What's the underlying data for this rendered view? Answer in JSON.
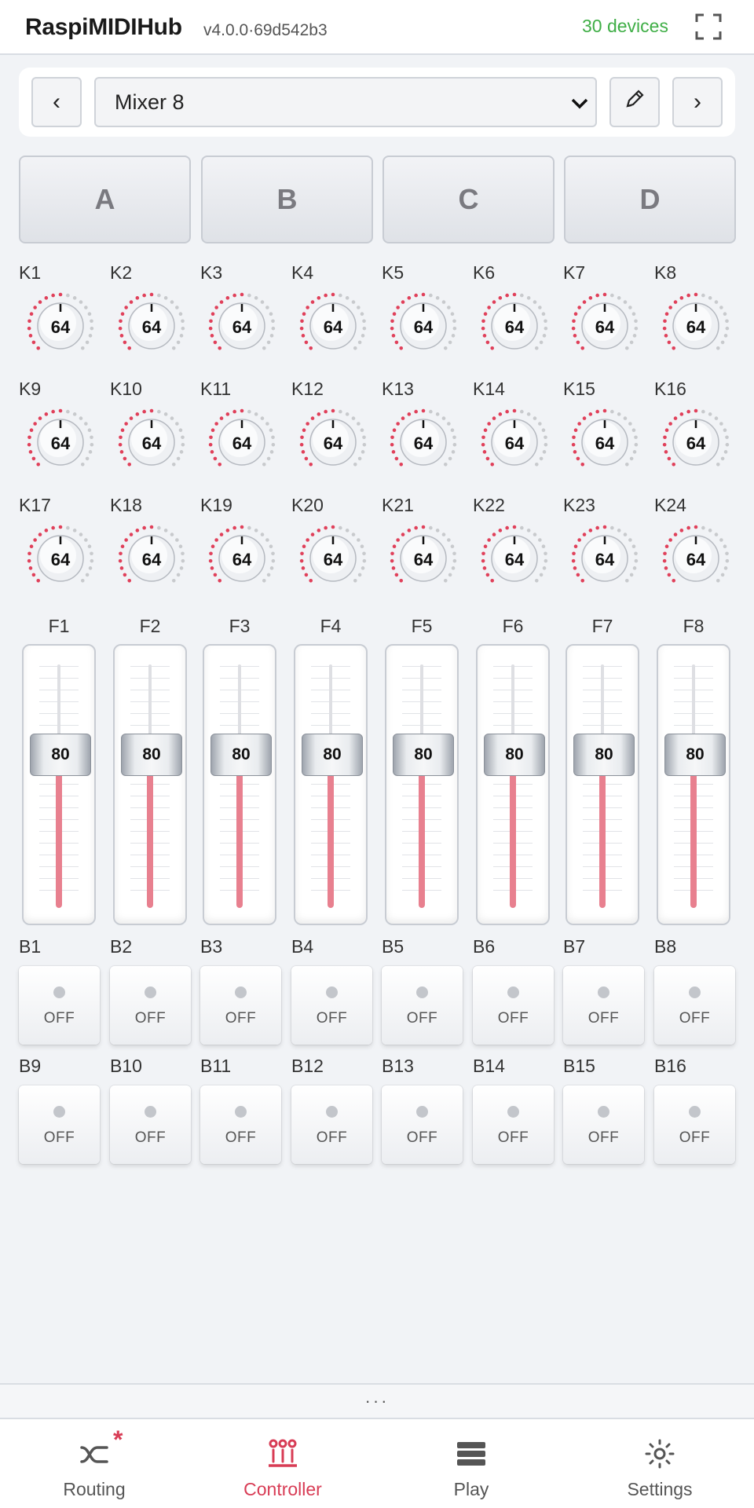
{
  "header": {
    "title": "RaspiMIDIHub",
    "version": "v4.0.0·69d542b3",
    "devices": "30 devices"
  },
  "preset": {
    "prev_label": "‹",
    "next_label": "›",
    "selected": "Mixer 8",
    "edit_icon": "pencil-icon"
  },
  "banks": [
    "A",
    "B",
    "C",
    "D"
  ],
  "knobs": [
    {
      "label": "K1",
      "value": "64"
    },
    {
      "label": "K2",
      "value": "64"
    },
    {
      "label": "K3",
      "value": "64"
    },
    {
      "label": "K4",
      "value": "64"
    },
    {
      "label": "K5",
      "value": "64"
    },
    {
      "label": "K6",
      "value": "64"
    },
    {
      "label": "K7",
      "value": "64"
    },
    {
      "label": "K8",
      "value": "64"
    },
    {
      "label": "K9",
      "value": "64"
    },
    {
      "label": "K10",
      "value": "64"
    },
    {
      "label": "K11",
      "value": "64"
    },
    {
      "label": "K12",
      "value": "64"
    },
    {
      "label": "K13",
      "value": "64"
    },
    {
      "label": "K14",
      "value": "64"
    },
    {
      "label": "K15",
      "value": "64"
    },
    {
      "label": "K16",
      "value": "64"
    },
    {
      "label": "K17",
      "value": "64"
    },
    {
      "label": "K18",
      "value": "64"
    },
    {
      "label": "K19",
      "value": "64"
    },
    {
      "label": "K20",
      "value": "64"
    },
    {
      "label": "K21",
      "value": "64"
    },
    {
      "label": "K22",
      "value": "64"
    },
    {
      "label": "K23",
      "value": "64"
    },
    {
      "label": "K24",
      "value": "64"
    }
  ],
  "knob_level": 0.5,
  "faders": [
    {
      "label": "F1",
      "value": "80"
    },
    {
      "label": "F2",
      "value": "80"
    },
    {
      "label": "F3",
      "value": "80"
    },
    {
      "label": "F4",
      "value": "80"
    },
    {
      "label": "F5",
      "value": "80"
    },
    {
      "label": "F6",
      "value": "80"
    },
    {
      "label": "F7",
      "value": "80"
    },
    {
      "label": "F8",
      "value": "80"
    }
  ],
  "fader_level": 0.63,
  "buttons": [
    {
      "label": "B1",
      "state": "OFF"
    },
    {
      "label": "B2",
      "state": "OFF"
    },
    {
      "label": "B3",
      "state": "OFF"
    },
    {
      "label": "B4",
      "state": "OFF"
    },
    {
      "label": "B5",
      "state": "OFF"
    },
    {
      "label": "B6",
      "state": "OFF"
    },
    {
      "label": "B7",
      "state": "OFF"
    },
    {
      "label": "B8",
      "state": "OFF"
    },
    {
      "label": "B9",
      "state": "OFF"
    },
    {
      "label": "B10",
      "state": "OFF"
    },
    {
      "label": "B11",
      "state": "OFF"
    },
    {
      "label": "B12",
      "state": "OFF"
    },
    {
      "label": "B13",
      "state": "OFF"
    },
    {
      "label": "B14",
      "state": "OFF"
    },
    {
      "label": "B15",
      "state": "OFF"
    },
    {
      "label": "B16",
      "state": "OFF"
    }
  ],
  "handle": "···",
  "tabs": [
    {
      "label": "Routing",
      "icon": "routing-icon",
      "badge": "*"
    },
    {
      "label": "Controller",
      "icon": "controller-icon",
      "active": true
    },
    {
      "label": "Play",
      "icon": "play-stack-icon"
    },
    {
      "label": "Settings",
      "icon": "gear-icon"
    }
  ],
  "colors": {
    "accent": "#d83c55",
    "devices_ok": "#3fae46",
    "knob_active_dot": "#e0405a",
    "knob_inactive_dot": "#c8cacd",
    "fader_fill": "#e8808f"
  }
}
